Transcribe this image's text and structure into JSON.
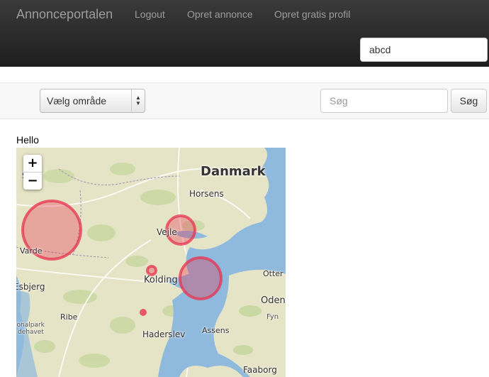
{
  "navbar": {
    "brand": "Annonceportalen",
    "links": [
      "Logout",
      "Opret annonce",
      "Opret gratis profil"
    ],
    "search_value": "abcd"
  },
  "filter": {
    "area_select": "Vælg område",
    "search_placeholder": "Søg",
    "search_button": "Søg"
  },
  "content": {
    "greeting": "Hello"
  },
  "map": {
    "zoom_in": "+",
    "zoom_out": "−",
    "labels": {
      "country": "Danmark",
      "horsens": "Horsens",
      "vejle": "Vejle",
      "varde": "Varde",
      "kolding": "Kolding",
      "otter": "Otter",
      "esbjerg": "Esbjerg",
      "ribe": "Ribe",
      "odense": "Odens",
      "fyn": "Fyn",
      "nationalpark": "ionalpark",
      "vadehavet": "dehavet",
      "haderslev": "Haderslev",
      "assens": "Assens",
      "faaborg": "Faaborg",
      "partial_s": "S"
    },
    "colors": {
      "land": "#e6e4c6",
      "water": "#8fb9dd",
      "marker": "#e8334f"
    }
  }
}
